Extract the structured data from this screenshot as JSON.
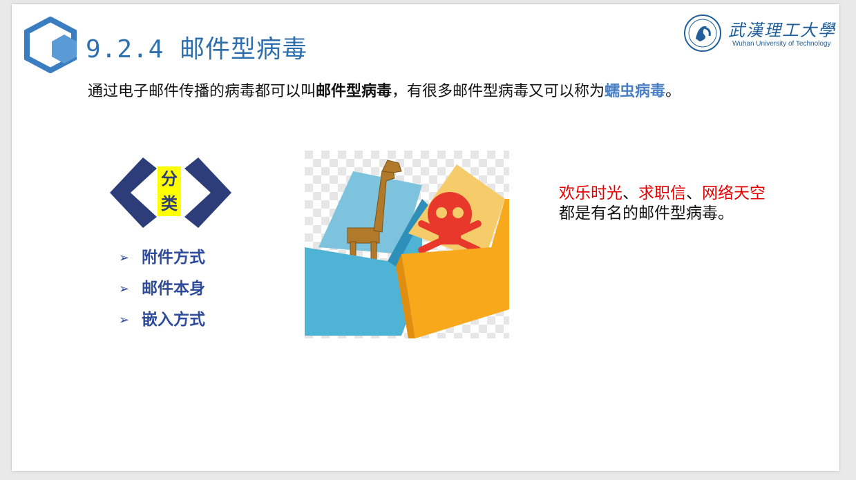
{
  "slide": {
    "title": "9.2.4 邮件型病毒",
    "logo": {
      "name": "武漢理工大學",
      "subtitle": "Wuhan University of Technology"
    },
    "intro": {
      "part1": "通过电子邮件传播的病毒都可以叫",
      "bold1": "邮件型病毒",
      "part2": "，有很多邮件型病毒又可以称为",
      "bold2": "蠕虫病毒",
      "end": "。"
    },
    "category": {
      "label": "分类",
      "items": [
        {
          "label": "附件方式"
        },
        {
          "label": "邮件本身"
        },
        {
          "label": "嵌入方式"
        }
      ]
    },
    "examples": {
      "name1": "欢乐时光",
      "sep1": "、",
      "name2": "求职信",
      "sep2": "、",
      "name3": "网络天空",
      "rest": "都是有名的邮件型病毒。"
    }
  },
  "colors": {
    "title": "#2e6fae",
    "accent_dark": "#2c3d7a",
    "highlight": "#ffff00",
    "red": "#e60000",
    "worm_blue": "#4a7fc5"
  }
}
